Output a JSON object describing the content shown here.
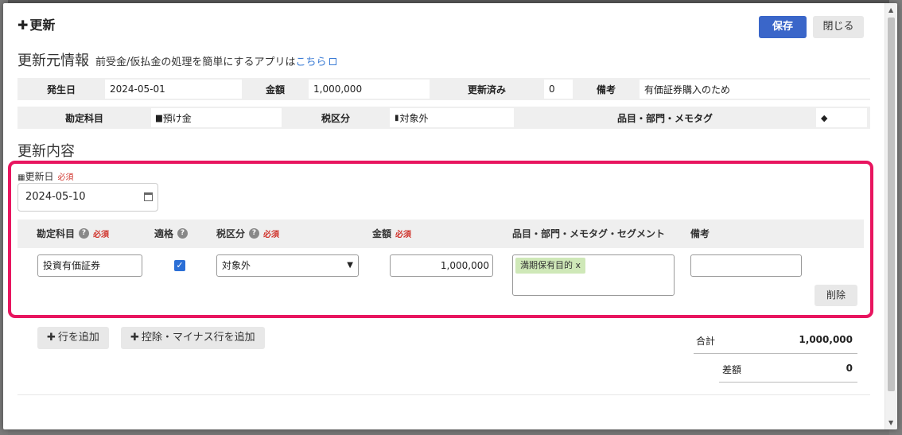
{
  "modal": {
    "title": "更新",
    "save_label": "保存",
    "close_label": "閉じる"
  },
  "source_info": {
    "heading": "更新元情報",
    "note_prefix": "前受金/仮払金の処理を簡単にするアプリは",
    "note_link": "こちら",
    "row1": {
      "issue_date_label": "発生日",
      "issue_date": "2024-05-01",
      "amount_label": "金額",
      "amount": "1,000,000",
      "updated_label": "更新済み",
      "updated": "0",
      "remarks_label": "備考",
      "remarks": "有価証券購入のため"
    },
    "row2": {
      "account_label": "勘定科目",
      "account": "預け金",
      "tax_label": "税区分",
      "tax": "対象外",
      "items_label": "品目・部門・メモタグ"
    }
  },
  "update_content": {
    "heading": "更新内容",
    "date_label": "更新日",
    "required": "必須",
    "date_value": "2024-05-10",
    "columns": {
      "account": "勘定科目",
      "eligible": "適格",
      "tax": "税区分",
      "amount": "金額",
      "items": "品目・部門・メモタグ・セグメント",
      "remarks": "備考"
    },
    "row": {
      "account": "投資有価証券",
      "eligible_checked": true,
      "tax": "対象外",
      "amount": "1,000,000",
      "tag": "満期保有目的",
      "tag_remove": "x",
      "remarks": "",
      "delete_label": "削除"
    },
    "add_row_label": "行を追加",
    "add_minus_row_label": "控除・マイナス行を追加"
  },
  "totals": {
    "total_label": "合計",
    "total_value": "1,000,000",
    "diff_label": "差額",
    "diff_value": "0"
  },
  "colors": {
    "primary": "#3a66c9",
    "highlight_border": "#e8155f",
    "required": "#d0342c",
    "tag_bg": "#cfe8b8"
  }
}
